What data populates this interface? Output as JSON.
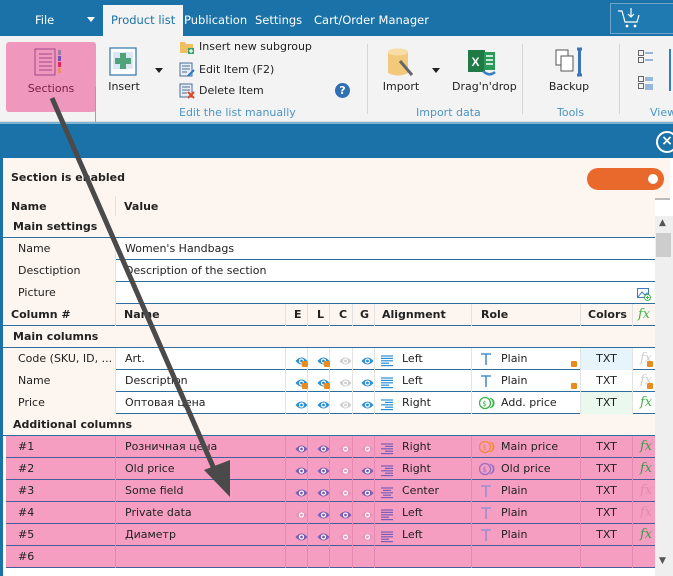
{
  "menubar": {
    "tabs": [
      "File",
      "Product list",
      "Publication",
      "Settings",
      "Cart/Order Manager"
    ],
    "active_tab": "Product list"
  },
  "ribbon": {
    "sections_label": "Sections",
    "insert_label": "Insert",
    "insert_subgroup_label": "Insert new subgroup",
    "edit_item_label": "Edit Item  (F2)",
    "delete_item_label": "Delete Item",
    "group_edit_label": "Edit the list manually",
    "import_label": "Import",
    "dragndrop_label": "Drag'n'drop",
    "group_import_label": "Import data",
    "backup_label": "Backup",
    "group_tools_label": "Tools",
    "group_view_label": "View"
  },
  "panel": {
    "enabled_label": "Section is enabled",
    "enabled": true,
    "settings_header": {
      "name": "Name",
      "value": "Value"
    },
    "main_settings_label": "Main settings",
    "settings": [
      {
        "name": "Name",
        "value": "Women's Handbags"
      },
      {
        "name": "Desctiption",
        "value": "Description of the section"
      },
      {
        "name": "Picture",
        "value": ""
      }
    ],
    "columns_header": {
      "column": "Column #",
      "name": "Name",
      "e": "E",
      "l": "L",
      "c": "C",
      "g": "G",
      "alignment": "Alignment",
      "role": "Role",
      "colors": "Colors",
      "fx": "fx"
    },
    "main_columns_label": "Main columns",
    "main_columns": [
      {
        "column": "Code (SKU, ID, ...",
        "name": "Art.",
        "e": "on-locked",
        "l": "on-locked",
        "c": "off",
        "g": "on",
        "alignment": "Left",
        "role": "Plain",
        "role_icon": "text-icon",
        "role_locked": true,
        "colors": "TXT",
        "fx": "locked"
      },
      {
        "column": "Name",
        "name": "Description",
        "e": "on-locked",
        "l": "on-locked",
        "c": "off",
        "g": "on",
        "alignment": "Left",
        "role": "Plain",
        "role_icon": "text-icon",
        "role_locked": true,
        "colors": "TXT",
        "fx": "locked"
      },
      {
        "column": "Price",
        "name": "Оптовая цена",
        "e": "on",
        "l": "on",
        "c": "off",
        "g": "on",
        "alignment": "Right",
        "role": "Add. price",
        "role_icon": "coins-green-icon",
        "role_locked": false,
        "colors": "TXT",
        "fx": "on"
      }
    ],
    "additional_columns_label": "Additional columns",
    "additional_columns": [
      {
        "column": "#1",
        "name": "Розничная цена",
        "e": "on",
        "l": "on",
        "c": "off",
        "g": "off",
        "alignment": "Right",
        "role": "Main price",
        "role_icon": "coins-orange-icon",
        "colors": "TXT",
        "fx": "on"
      },
      {
        "column": "#2",
        "name": "Old price",
        "e": "on",
        "l": "on",
        "c": "off",
        "g": "on",
        "alignment": "Right",
        "role": "Old price",
        "role_icon": "coins-purple-icon",
        "colors": "TXT",
        "fx": "on"
      },
      {
        "column": "#3",
        "name": "Some field",
        "e": "on",
        "l": "on",
        "c": "off",
        "g": "on",
        "alignment": "Center",
        "role": "Plain",
        "role_icon": "text-icon",
        "colors": "TXT",
        "fx": "off"
      },
      {
        "column": "#4",
        "name": "Private data",
        "e": "off",
        "l": "on",
        "c": "on",
        "g": "off",
        "alignment": "Left",
        "role": "Plain",
        "role_icon": "text-icon",
        "colors": "TXT",
        "fx": "off"
      },
      {
        "column": "#5",
        "name": "Диаметр",
        "e": "on",
        "l": "on",
        "c": "off",
        "g": "off",
        "alignment": "Left",
        "role": "Plain",
        "role_icon": "text-icon",
        "colors": "TXT",
        "fx": "on"
      },
      {
        "column": "#6",
        "name": "",
        "e": "",
        "l": "",
        "c": "",
        "g": "",
        "alignment": "",
        "role": "",
        "role_icon": "",
        "colors": "",
        "fx": ""
      }
    ]
  },
  "colors": {
    "brand_blue": "#1b72a8",
    "highlight_pink": "#f59ec1",
    "toggle_orange": "#e8692b",
    "eye_blue": "#2a8fd6",
    "eye_purple": "#7a5db5",
    "fx_green": "#3bb54a"
  }
}
